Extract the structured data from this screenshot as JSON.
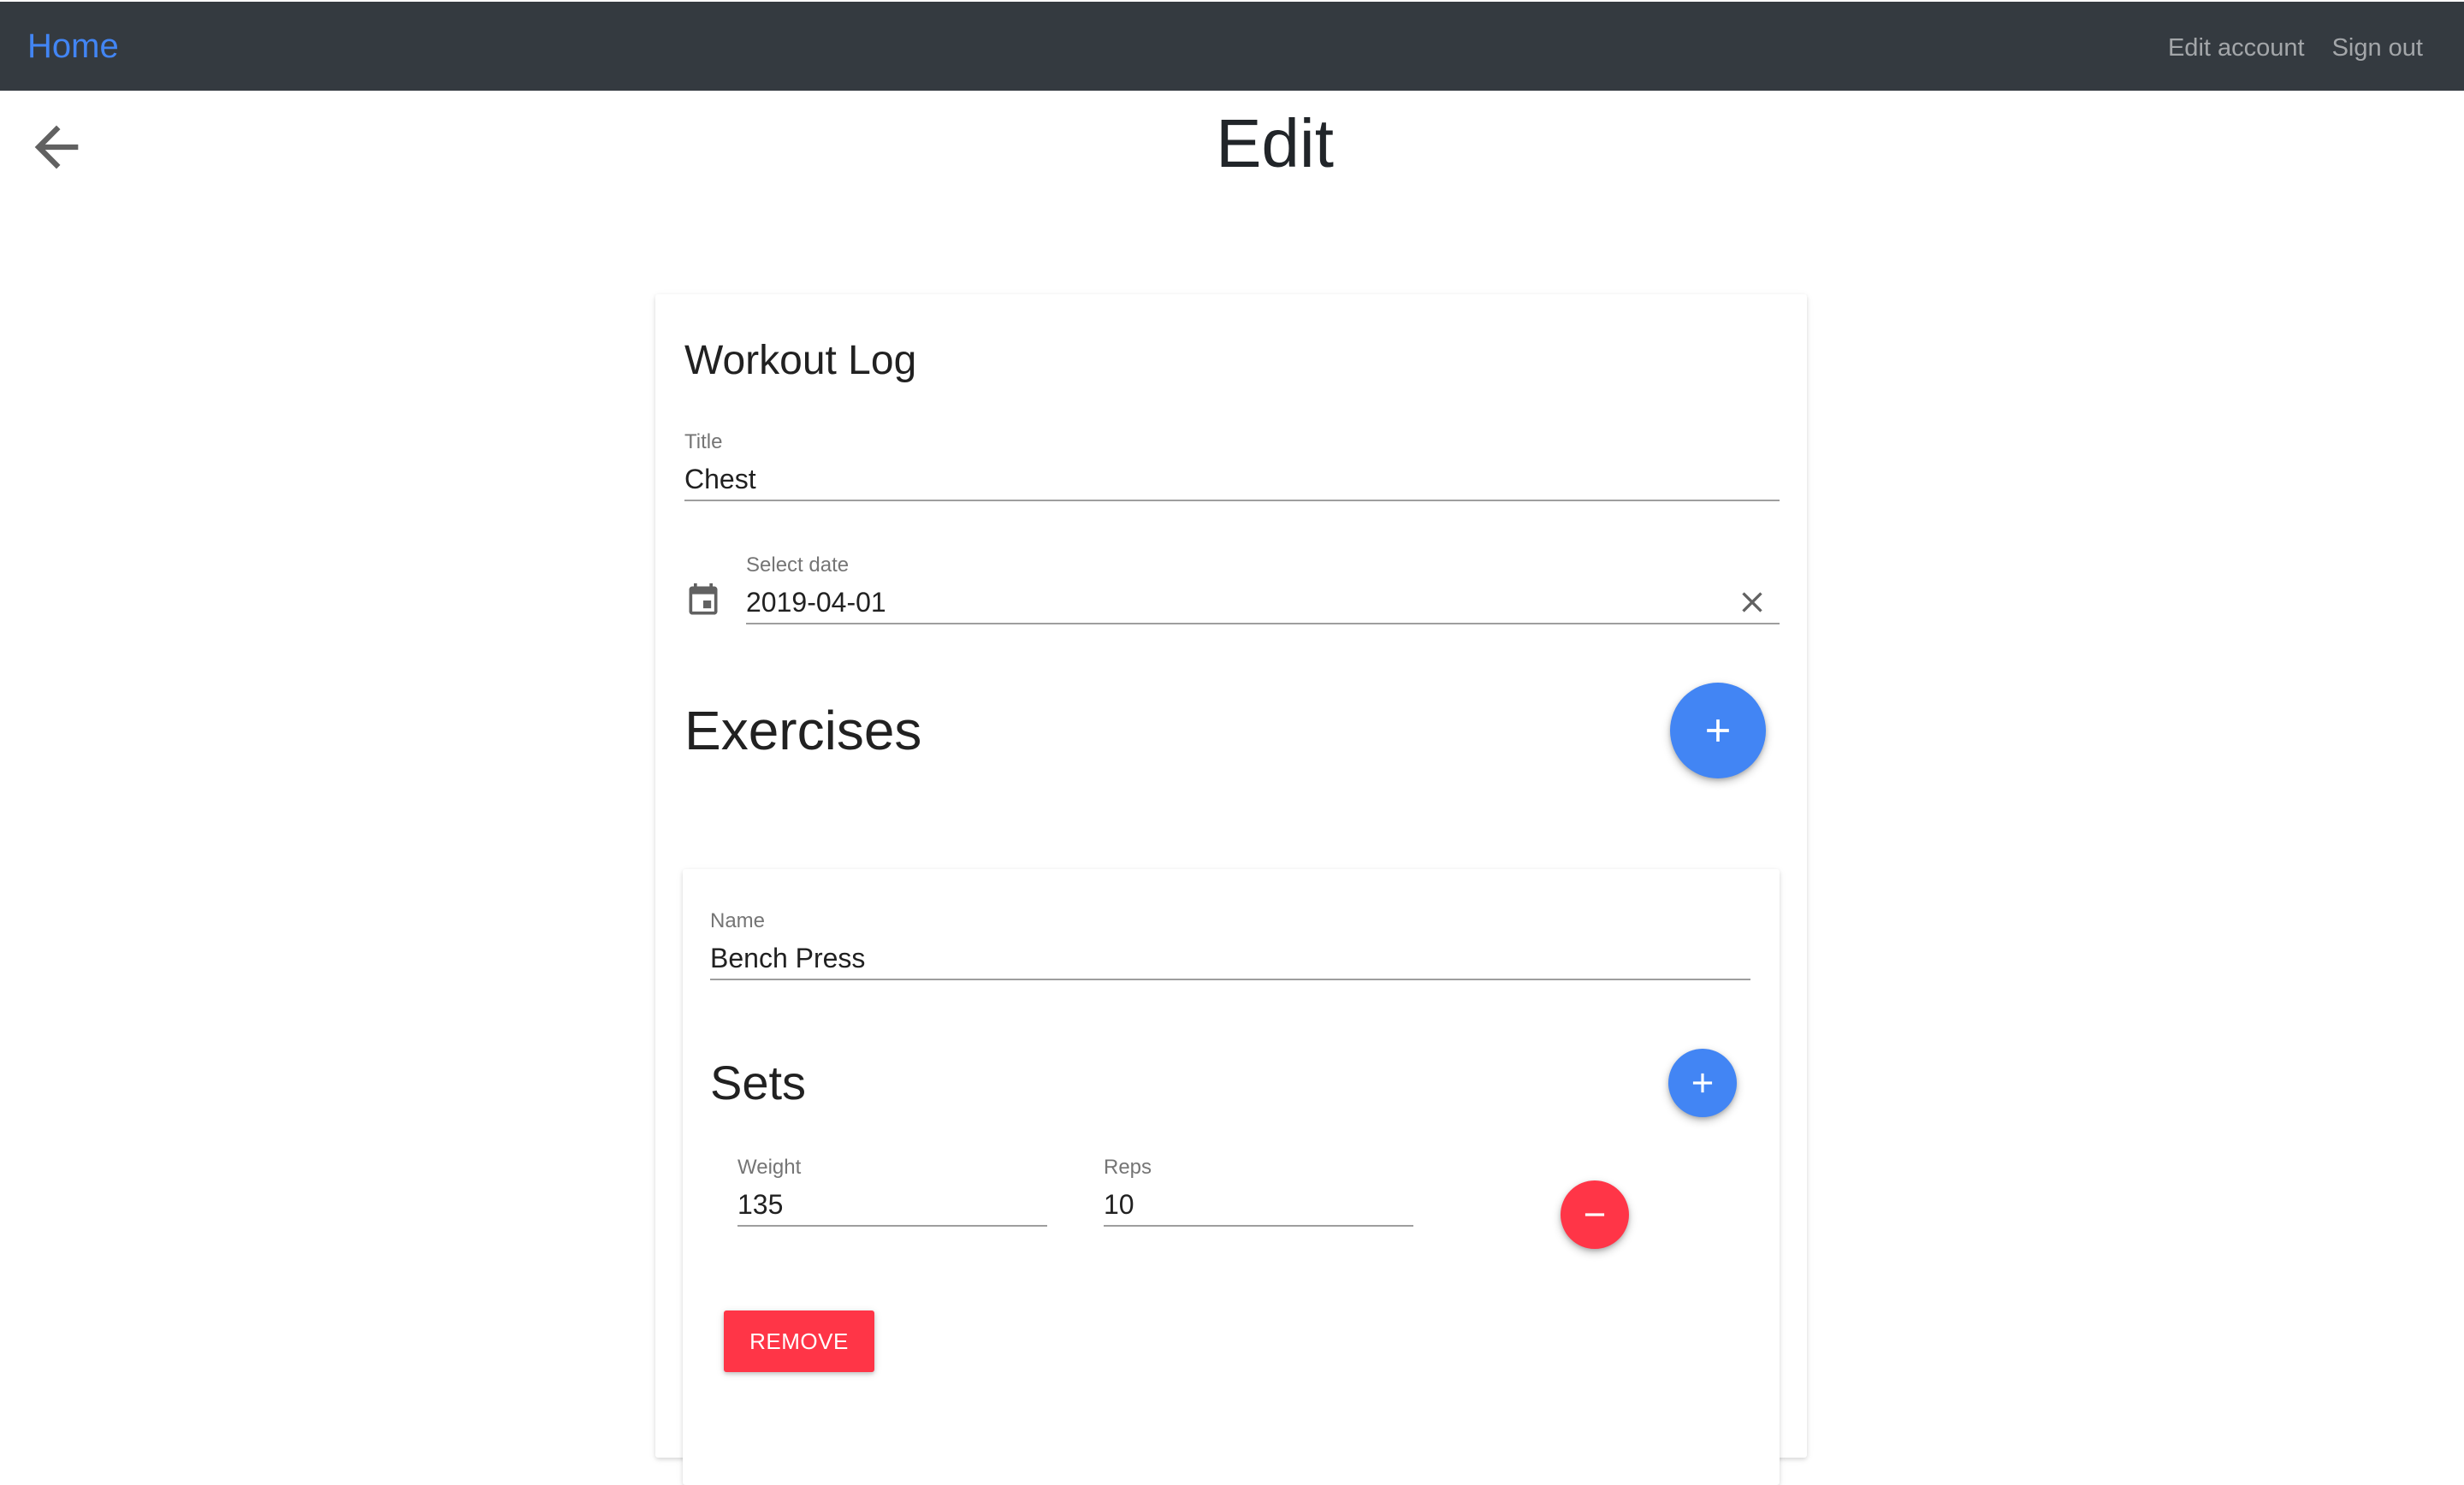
{
  "navbar": {
    "home_label": "Home",
    "edit_account_label": "Edit account",
    "sign_out_label": "Sign out"
  },
  "page": {
    "title": "Edit"
  },
  "form": {
    "card_title": "Workout Log",
    "title_field": {
      "label": "Title",
      "value": "Chest"
    },
    "date_field": {
      "label": "Select date",
      "value": "2019-04-01"
    },
    "exercises_heading": "Exercises",
    "exercise": {
      "name_label": "Name",
      "name_value": "Bench Press",
      "sets_heading": "Sets",
      "set": {
        "weight_label": "Weight",
        "weight_value": "135",
        "reps_label": "Reps",
        "reps_value": "10"
      },
      "remove_label": "REMOVE"
    }
  },
  "colors": {
    "navbar_bg": "#343a40",
    "primary": "#4285f4",
    "danger": "#ff3547"
  },
  "icons": {
    "back": "arrow-left-icon",
    "calendar": "calendar-icon",
    "clear": "close-icon",
    "add": "plus-icon",
    "remove": "minus-icon"
  }
}
